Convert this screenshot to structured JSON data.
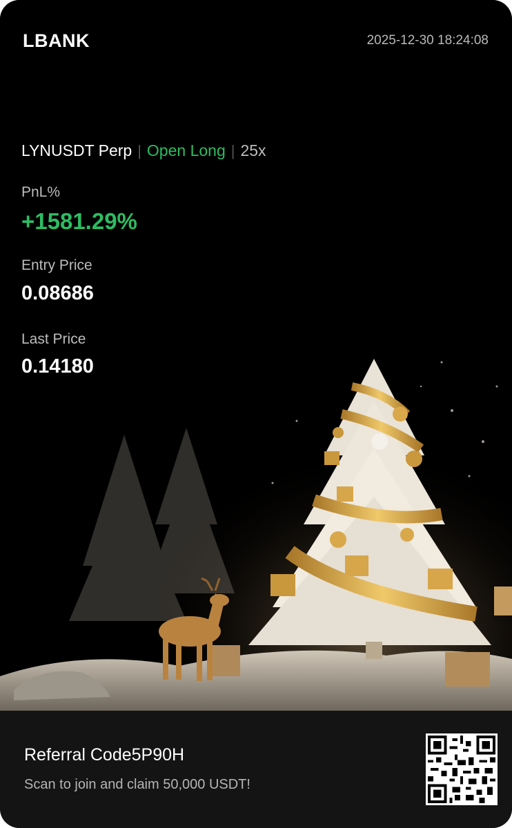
{
  "header": {
    "logo_text": "LBANK",
    "timestamp": "2025-12-30 18:24:08"
  },
  "position": {
    "symbol": "LYNUSDT Perp",
    "side": "Open Long",
    "leverage": "25x"
  },
  "metrics": {
    "pnl_label": "PnL%",
    "pnl_value": "+1581.29%",
    "entry_label": "Entry Price",
    "entry_value": "0.08686",
    "last_label": "Last Price",
    "last_value": "0.14180"
  },
  "footer": {
    "referral_label": "Referral Code",
    "referral_code": "5P90H",
    "scan_text": "Scan to join and claim 50,000 USDT!"
  },
  "colors": {
    "background": "#000000",
    "profit_green": "#2dbc63",
    "footer_bg": "#141414",
    "gold": "#d4a548"
  }
}
